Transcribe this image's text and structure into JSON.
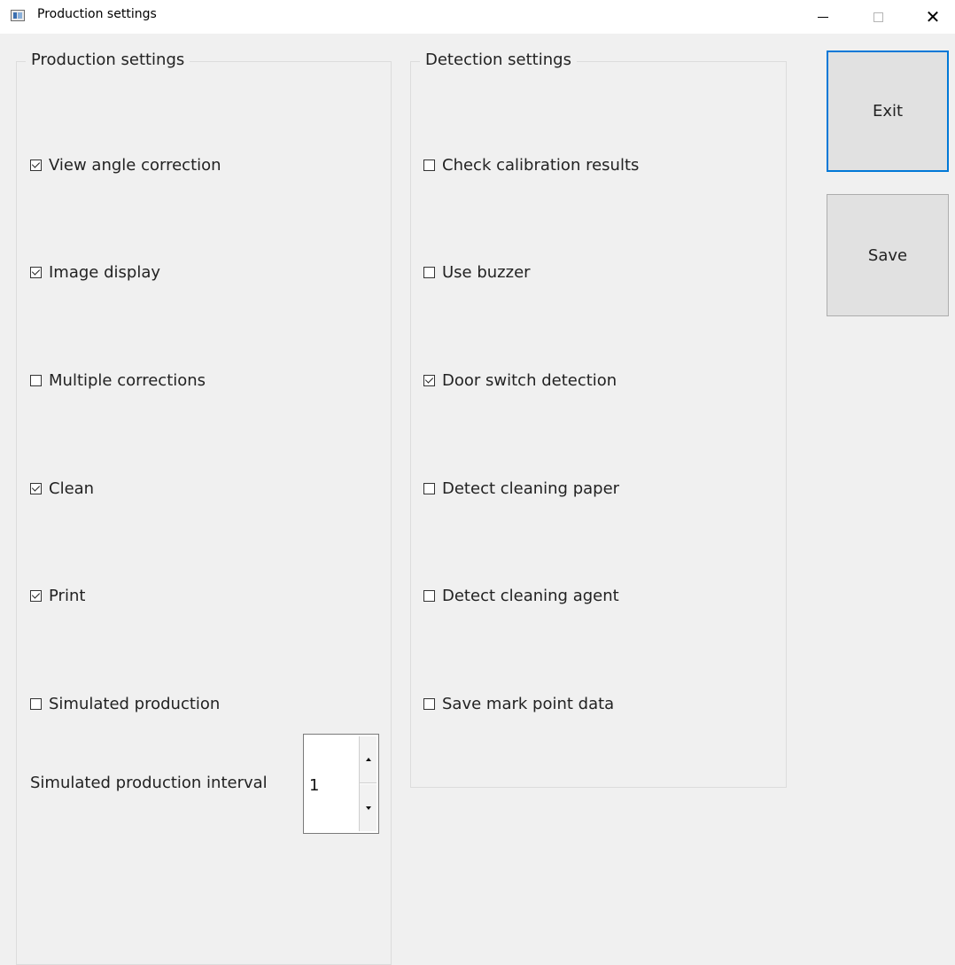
{
  "window": {
    "title": "Production settings",
    "icons": [
      "app-icon",
      "minimize-icon",
      "maximize-icon",
      "close-icon"
    ]
  },
  "production_group": {
    "title": "Production settings",
    "items": [
      {
        "label": "View angle correction",
        "checked": true
      },
      {
        "label": "Image display",
        "checked": true
      },
      {
        "label": "Multiple corrections",
        "checked": false
      },
      {
        "label": "Clean",
        "checked": true
      },
      {
        "label": "Print",
        "checked": true
      },
      {
        "label": "Simulated production",
        "checked": false
      }
    ],
    "interval_label": "Simulated production interval",
    "interval_value": "1"
  },
  "detection_group": {
    "title": "Detection settings",
    "items": [
      {
        "label": "Check calibration results",
        "checked": false
      },
      {
        "label": "Use buzzer",
        "checked": false
      },
      {
        "label": "Door switch detection",
        "checked": true
      },
      {
        "label": "Detect cleaning paper",
        "checked": false
      },
      {
        "label": "Detect cleaning agent",
        "checked": false
      },
      {
        "label": "Save mark point data",
        "checked": false
      }
    ]
  },
  "buttons": {
    "exit": "Exit",
    "save": "Save"
  },
  "colors": {
    "focus_border": "#0078d7",
    "background": "#f0f0f0"
  }
}
